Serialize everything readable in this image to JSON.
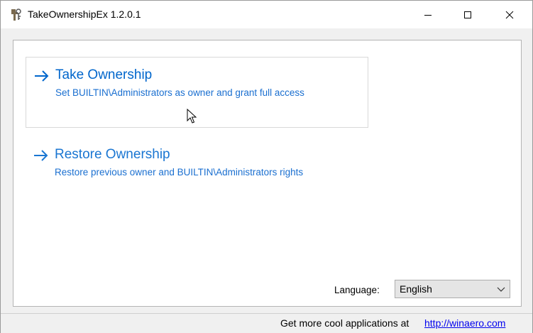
{
  "window": {
    "title": "TakeOwnershipEx 1.2.0.1",
    "controls": [
      "minimize-icon",
      "maximize-icon",
      "close-icon"
    ]
  },
  "actions": [
    {
      "icon": "arrow-right-icon",
      "heading": "Take Ownership",
      "description": "Set BUILTIN\\Administrators as owner and grant full access"
    },
    {
      "icon": "arrow-right-icon",
      "heading": "Restore Ownership",
      "description": "Restore previous owner and BUILTIN\\Administrators rights"
    }
  ],
  "language": {
    "label": "Language:",
    "selected": "English"
  },
  "footer": {
    "text": "Get more cool applications at",
    "link": "http://winaero.com"
  },
  "colors": {
    "accent": "#0066cc",
    "link": "#0000ee",
    "background": "#f0f0f0"
  }
}
